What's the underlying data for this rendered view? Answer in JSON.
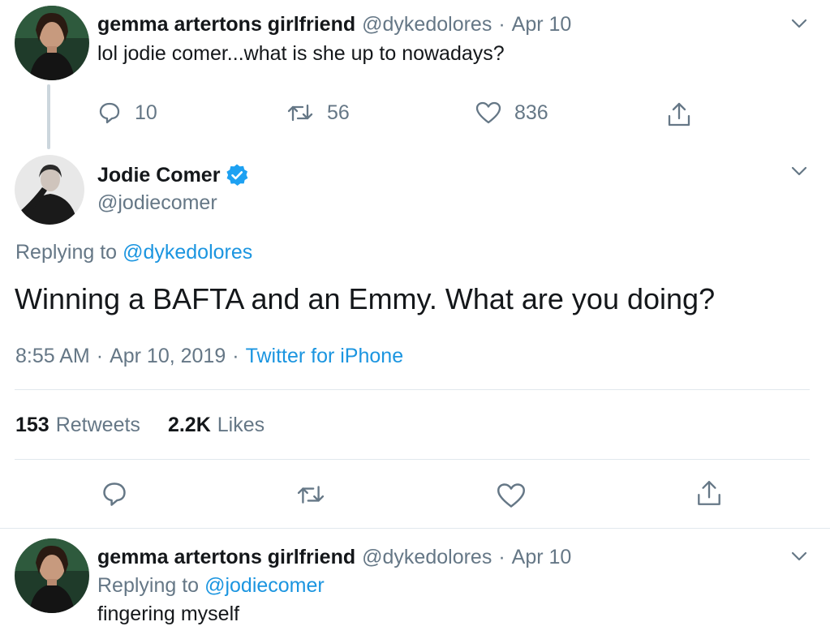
{
  "colors": {
    "link_blue": "#1b95e0",
    "secondary_gray": "#657786",
    "text": "#14171a",
    "divider": "#e1e8ed",
    "verified_blue": "#1da1f2"
  },
  "tweet1": {
    "display_name": "gemma artertons girlfriend",
    "handle": "@dykedolores",
    "separator": "·",
    "date": "Apr 10",
    "text": "lol jodie comer...what is she up to nowadays?",
    "reply_count": "10",
    "retweet_count": "56",
    "like_count": "836"
  },
  "main_tweet": {
    "display_name": "Jodie Comer",
    "handle": "@jodiecomer",
    "verified": true,
    "replying_prefix": "Replying to",
    "replying_to": "@dykedolores",
    "text": "Winning a BAFTA and an Emmy. What are you doing?",
    "time": "8:55 AM",
    "sep1": "·",
    "date": "Apr 10, 2019",
    "sep2": "·",
    "source": "Twitter for iPhone",
    "retweets_count": "153",
    "retweets_label": "Retweets",
    "likes_count": "2.2K",
    "likes_label": "Likes"
  },
  "tweet3": {
    "display_name": "gemma artertons girlfriend",
    "handle": "@dykedolores",
    "separator": "·",
    "date": "Apr 10",
    "replying_prefix": "Replying to",
    "replying_to": "@jodiecomer",
    "text": "fingering myself"
  },
  "icons": {
    "reply": "reply-icon",
    "retweet": "retweet-icon",
    "like": "heart-icon",
    "share": "share-icon",
    "more": "chevron-down-icon",
    "verified": "verified-badge-icon"
  }
}
